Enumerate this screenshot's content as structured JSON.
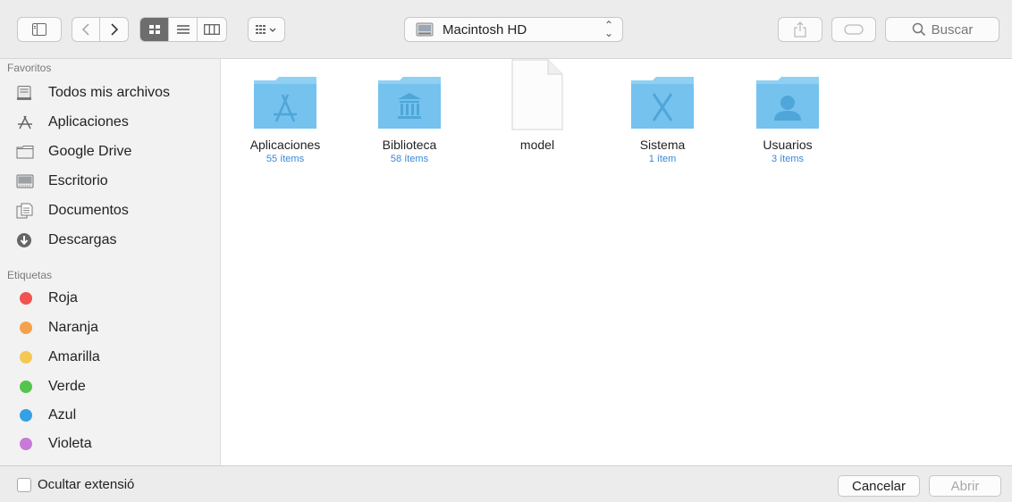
{
  "toolbar": {
    "location_label": "Macintosh HD",
    "search_placeholder": "Buscar"
  },
  "sidebar": {
    "favorites_header": "Favoritos",
    "favorites": [
      {
        "label": "Todos mis archivos",
        "icon": "all-files-icon"
      },
      {
        "label": "Aplicaciones",
        "icon": "applications-icon"
      },
      {
        "label": "Google Drive",
        "icon": "folder-icon"
      },
      {
        "label": "Escritorio",
        "icon": "desktop-icon"
      },
      {
        "label": "Documentos",
        "icon": "documents-icon"
      },
      {
        "label": "Descargas",
        "icon": "downloads-icon"
      }
    ],
    "tags_header": "Etiquetas",
    "tags": [
      {
        "label": "Roja",
        "color": "#f1524f"
      },
      {
        "label": "Naranja",
        "color": "#f5a04d"
      },
      {
        "label": "Amarilla",
        "color": "#f5c855"
      },
      {
        "label": "Verde",
        "color": "#53c54c"
      },
      {
        "label": "Azul",
        "color": "#36a0e6"
      },
      {
        "label": "Violeta",
        "color": "#c77ad8"
      }
    ]
  },
  "files": [
    {
      "name": "Aplicaciones",
      "count": "55 ítems",
      "icon": "applications-folder-icon"
    },
    {
      "name": "Biblioteca",
      "count": "58 ítems",
      "icon": "library-folder-icon"
    },
    {
      "name": "model",
      "count": "",
      "icon": "document-icon"
    },
    {
      "name": "Sistema",
      "count": "1 ítem",
      "icon": "system-folder-icon"
    },
    {
      "name": "Usuarios",
      "count": "3 ítems",
      "icon": "users-folder-icon"
    }
  ],
  "bottom": {
    "hide_extension_label": "Ocultar extensió",
    "cancel_label": "Cancelar",
    "open_label": "Abrir"
  },
  "colors": {
    "folder": "#75c2ee",
    "accent": "#3b86d8"
  }
}
